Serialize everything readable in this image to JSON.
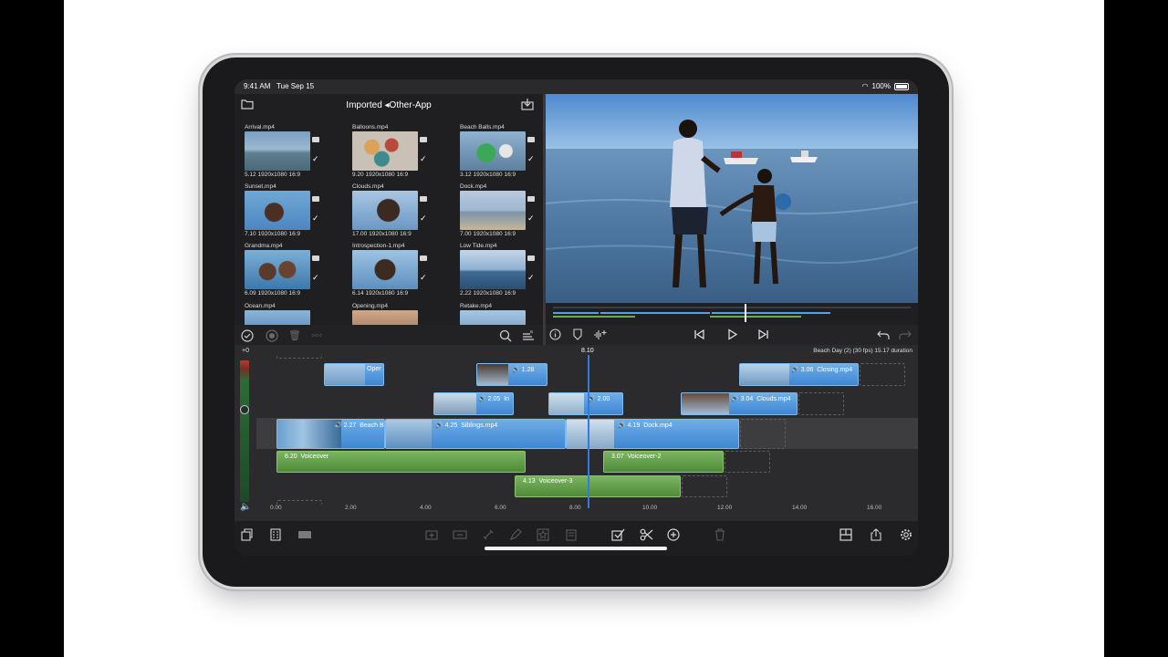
{
  "status_bar": {
    "time": "9:41 AM",
    "date": "Tue Sep 15",
    "battery": "100%"
  },
  "browser": {
    "title": "Imported ◂Other-App",
    "clips": [
      {
        "name": "Arrival.mp4",
        "duration": "5.12",
        "resolution": "1920x1080",
        "aspect": "16:9"
      },
      {
        "name": "Balloons.mp4",
        "duration": "9.20",
        "resolution": "1920x1080",
        "aspect": "16:9"
      },
      {
        "name": "Beach Balls.mp4",
        "duration": "3.12",
        "resolution": "1920x1080",
        "aspect": "16:9"
      },
      {
        "name": "Sunset.mp4",
        "duration": "7.10",
        "resolution": "1920x1080",
        "aspect": "16:9"
      },
      {
        "name": "Clouds.mp4",
        "duration": "17.00",
        "resolution": "1920x1080",
        "aspect": "16:9"
      },
      {
        "name": "Dock.mp4",
        "duration": "7.00",
        "resolution": "1920x1080",
        "aspect": "16:9"
      },
      {
        "name": "Grandma.mp4",
        "duration": "6.09",
        "resolution": "1920x1080",
        "aspect": "16:9"
      },
      {
        "name": "Introspection-1.mp4",
        "duration": "6.14",
        "resolution": "1920x1080",
        "aspect": "16:9"
      },
      {
        "name": "Low Tide.mp4",
        "duration": "2.22",
        "resolution": "1920x1080",
        "aspect": "16:9"
      },
      {
        "name": "Ocean.mp4",
        "duration": "",
        "resolution": "",
        "aspect": ""
      },
      {
        "name": "Opening.mp4",
        "duration": "",
        "resolution": "",
        "aspect": ""
      },
      {
        "name": "Retake.mp4",
        "duration": "",
        "resolution": "",
        "aspect": ""
      }
    ]
  },
  "timeline": {
    "project_info": "Beach Day (2) (30 fps)  15.17 duration",
    "playhead_time": "8.10",
    "meter_label": "+0",
    "clips": [
      {
        "label": "Oper",
        "duration": ""
      },
      {
        "label": "",
        "duration": "1.28"
      },
      {
        "label": "Closing.mp4",
        "duration": "3.06"
      },
      {
        "label": "In",
        "duration": "2.05"
      },
      {
        "label": "",
        "duration": "2.00"
      },
      {
        "label": "Clouds.mp4",
        "duration": "3.04"
      },
      {
        "label": "Beach B",
        "duration": "2.27"
      },
      {
        "label": "Siblings.mp4",
        "duration": "4.25"
      },
      {
        "label": "Dock.mp4",
        "duration": "4.19"
      },
      {
        "label": "Voiceover",
        "duration": "6.20"
      },
      {
        "label": "Voiceover-2",
        "duration": "3.07"
      },
      {
        "label": "Voiceover-3",
        "duration": "4.13"
      }
    ],
    "ruler": [
      "0.00",
      "2.00",
      "4.00",
      "6.00",
      "8.00",
      "10.00",
      "12.00",
      "14.00",
      "16.00"
    ]
  },
  "colors": {
    "accent": "#2f7de1",
    "video_clip": "#4a90d9",
    "audio_clip": "#5f9a45",
    "background": "#2a2a2c"
  },
  "icons": {
    "browser": [
      "folder-icon",
      "import-icon"
    ],
    "browser_footer": [
      "checkmark-circle-icon",
      "record-icon",
      "trash-icon",
      "more-icon",
      "search-icon",
      "sort-icon"
    ],
    "transport": [
      "info-icon",
      "marker-icon",
      "add-audio-icon",
      "skip-back-icon",
      "play-icon",
      "skip-forward-icon",
      "undo-icon",
      "redo-icon"
    ],
    "toolbar": [
      "project-icon",
      "inspector-icon",
      "waveform-icon",
      "insert-icon",
      "connect-icon",
      "link-icon",
      "pen-icon",
      "favorite-icon",
      "clipboard-icon",
      "select-icon",
      "scissors-icon",
      "add-icon",
      "trash-icon",
      "layout-icon",
      "share-icon",
      "settings-icon"
    ]
  }
}
